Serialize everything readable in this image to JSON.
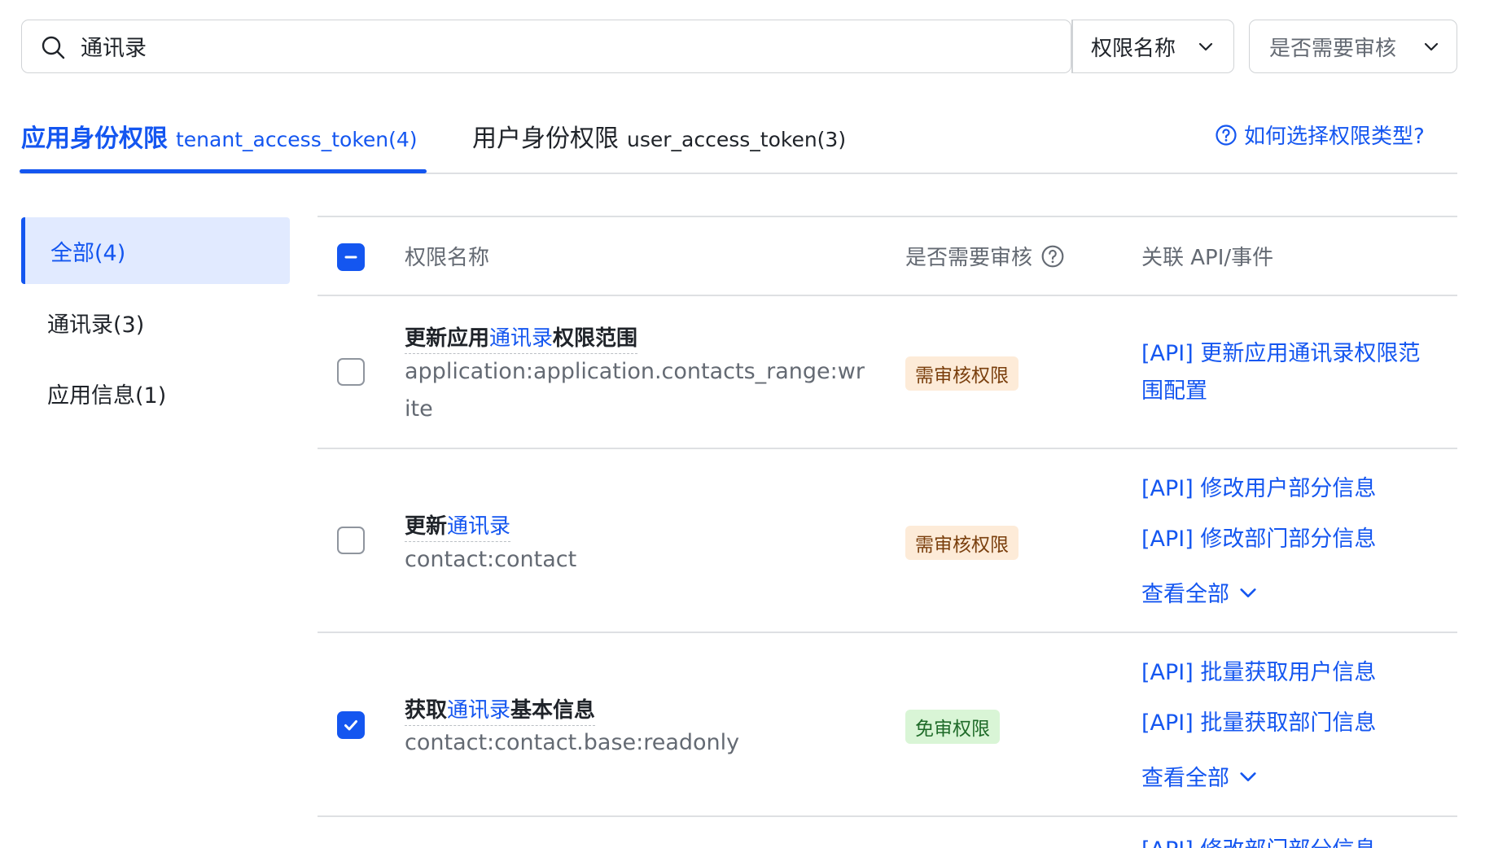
{
  "search": {
    "value": "通讯录",
    "filter_name_label": "权限名称",
    "filter_audit_label": "是否需要审核"
  },
  "tabs": [
    {
      "label": "应用身份权限",
      "token": "tenant_access_token(4)",
      "active": true
    },
    {
      "label": "用户身份权限",
      "token": "user_access_token(3)",
      "active": false
    }
  ],
  "help_link": "如何选择权限类型?",
  "sidebar": {
    "items": [
      {
        "label": "全部(4)",
        "active": true
      },
      {
        "label": "通讯录(3)",
        "active": false
      },
      {
        "label": "应用信息(1)",
        "active": false
      }
    ]
  },
  "table": {
    "headers": {
      "name": "权限名称",
      "audit": "是否需要审核",
      "api": "关联 API/事件"
    },
    "header_checkbox_state": "indeterminate",
    "rows": [
      {
        "title_prefix": "更新应用",
        "title_highlight": "通讯录",
        "title_suffix": "权限范围",
        "code_line1": "application:application.contacts_range:wr",
        "code_line2": "ite",
        "badge": "需审核权限",
        "checked": false,
        "apis": [
          "[API] 更新应用通讯录权限范",
          "围配置"
        ],
        "more": ""
      },
      {
        "title_prefix": "更新",
        "title_highlight": "通讯录",
        "title_suffix": "",
        "code_line1": "contact:contact",
        "badge": "需审核权限",
        "checked": false,
        "apis": [
          "[API] 修改用户部分信息",
          "[API] 修改部门部分信息"
        ],
        "more": "查看全部"
      },
      {
        "title_prefix": "获取",
        "title_highlight": "通讯录",
        "title_suffix": "基本信息",
        "code_line1": "contact:contact.base:readonly",
        "badge": "免审权限",
        "checked": true,
        "apis": [
          "[API] 批量获取用户信息",
          "[API] 批量获取部门信息"
        ],
        "more": "查看全部"
      }
    ],
    "partial_next_row_link": "[API] 修改部门部分信息"
  },
  "colors": {
    "accent": "#1456f0",
    "sidebar_active_bg": "#e1eaff",
    "badge_audit_bg": "#fdebd8",
    "badge_free_bg": "#d9f5d6"
  }
}
